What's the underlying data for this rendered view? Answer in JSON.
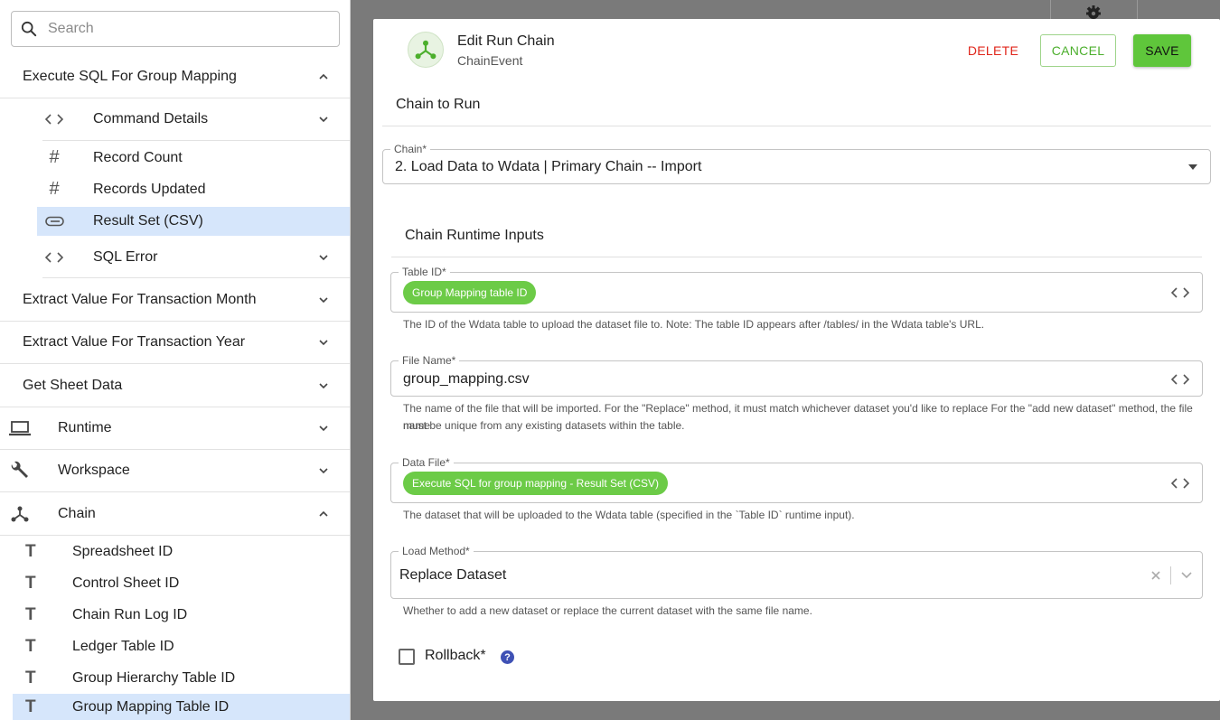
{
  "sidebar": {
    "search_placeholder": "Search",
    "items": [
      {
        "label": "Execute SQL For Group Mapping",
        "icon": "",
        "chevron": "up"
      },
      {
        "label": "Command Details",
        "icon": "code-icon",
        "chevron": "down"
      },
      {
        "label": "Record Count",
        "icon": "hash-icon"
      },
      {
        "label": "Records Updated",
        "icon": "hash-icon"
      },
      {
        "label": "Result Set (CSV)",
        "icon": "paperclip-icon",
        "selected": true
      },
      {
        "label": "SQL Error",
        "icon": "code-icon",
        "chevron": "down"
      },
      {
        "label": "Extract Value For Transaction Month",
        "icon": "",
        "chevron": "down"
      },
      {
        "label": "Extract Value For Transaction Year",
        "icon": "",
        "chevron": "down"
      },
      {
        "label": "Get Sheet Data",
        "icon": "",
        "chevron": "down"
      },
      {
        "label": "Runtime",
        "icon": "laptop-icon",
        "chevron": "down"
      },
      {
        "label": "Workspace",
        "icon": "wrench-icon",
        "chevron": "down"
      },
      {
        "label": "Chain",
        "icon": "chain-icon",
        "chevron": "up"
      },
      {
        "label": "Spreadsheet ID",
        "icon": "text-icon"
      },
      {
        "label": "Control Sheet ID",
        "icon": "text-icon"
      },
      {
        "label": "Chain Run Log ID",
        "icon": "text-icon"
      },
      {
        "label": "Ledger Table ID",
        "icon": "text-icon"
      },
      {
        "label": "Group Hierarchy Table ID",
        "icon": "text-icon"
      },
      {
        "label": "Group Mapping Table ID",
        "icon": "text-icon",
        "selected": true
      }
    ]
  },
  "modal": {
    "title": "Edit Run Chain",
    "subtitle": "ChainEvent",
    "delete_label": "DELETE",
    "cancel_label": "CANCEL",
    "save_label": "SAVE",
    "chain_to_run_heading": "Chain to Run",
    "chain_field": {
      "label": "Chain*",
      "value": "2. Load Data to Wdata | Primary Chain -- Import"
    },
    "runtime_inputs_heading": "Chain Runtime Inputs",
    "table_id": {
      "label": "Table ID*",
      "chip": "Group Mapping table ID",
      "help": "The ID of the Wdata table to upload the dataset file to. Note: The table ID appears after /tables/ in the Wdata table's URL."
    },
    "file_name": {
      "label": "File Name*",
      "value": "group_mapping.csv",
      "help_line1": "The name of the file that will be imported. For the \"Replace\" method, it must match whichever dataset you'd like to replace For the \"add new dataset\" method, the file name",
      "help_line2": "must be unique from any existing datasets within the table."
    },
    "data_file": {
      "label": "Data File*",
      "chip": "Execute SQL for group mapping - Result Set (CSV)",
      "help": "The dataset that will be uploaded to the Wdata table (specified in the `Table ID` runtime input)."
    },
    "load_method": {
      "label": "Load Method*",
      "value": "Replace Dataset",
      "help": "Whether to add a new dataset or replace the current dataset with the same file name."
    },
    "rollback_label": "Rollback*",
    "rollback_checked": false
  },
  "colors": {
    "accent_green": "#5fc63b",
    "chip_green": "#6ccb47",
    "delete_red": "#e0261b",
    "selected_bg": "#d6e6fb",
    "help_icon": "#3f51b5"
  }
}
